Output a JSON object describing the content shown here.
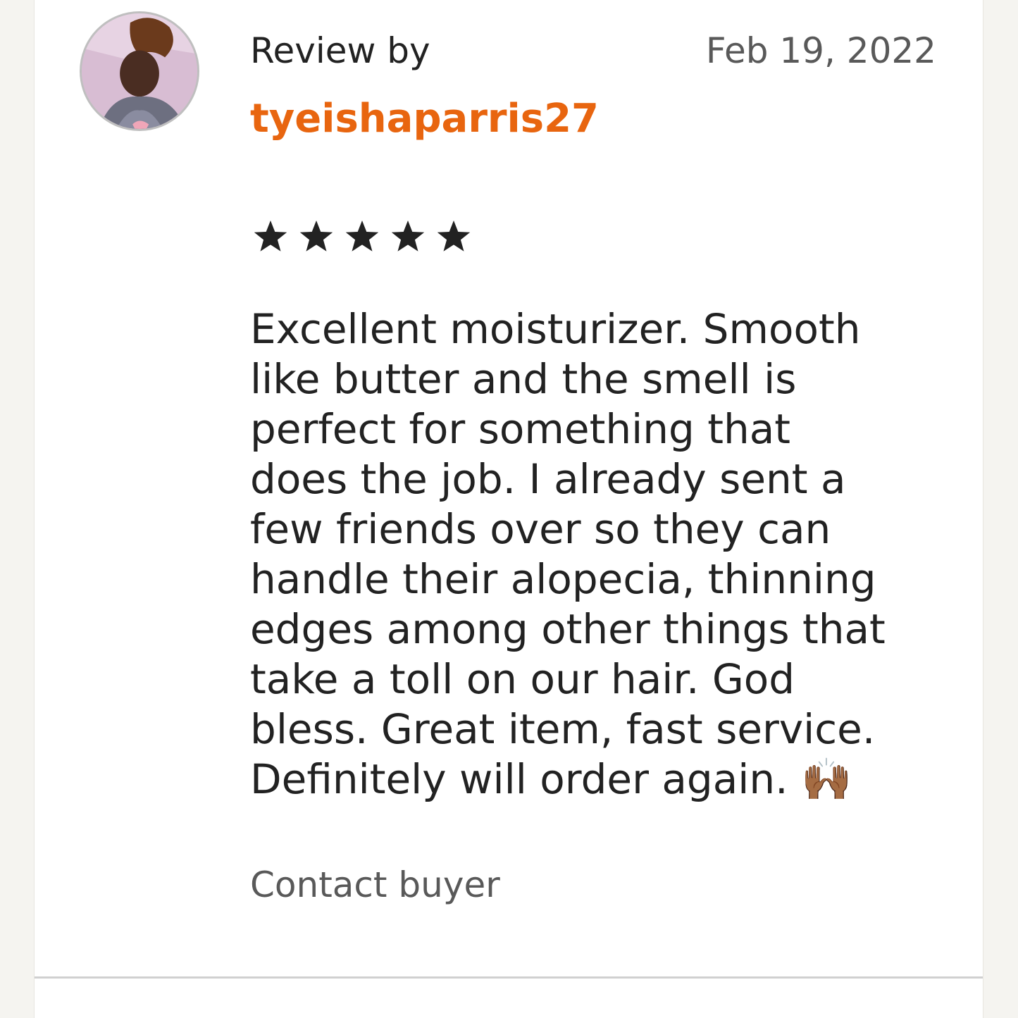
{
  "review": {
    "label": "Review by",
    "date": "Feb 19, 2022",
    "reviewer": "tyeishaparris27",
    "rating": 5,
    "rating_max": 5,
    "text": "Excellent moisturizer. Smooth\nlike butter and the smell is\nperfect for something that\ndoes the job. I already sent a\nfew friends over so they can\nhandle their alopecia, thinning\nedges among other things that\ntake a toll on our hair. God\nbless. Great item, fast service.\nDefinitely will order again. 🙌🏾",
    "contact_label": "Contact buyer"
  },
  "icons": {
    "avatar": "user-avatar-photo",
    "star": "star-filled-icon"
  },
  "colors": {
    "reviewer_name": "#e8650f",
    "star": "#222222",
    "text": "#222222",
    "muted": "#595959"
  }
}
